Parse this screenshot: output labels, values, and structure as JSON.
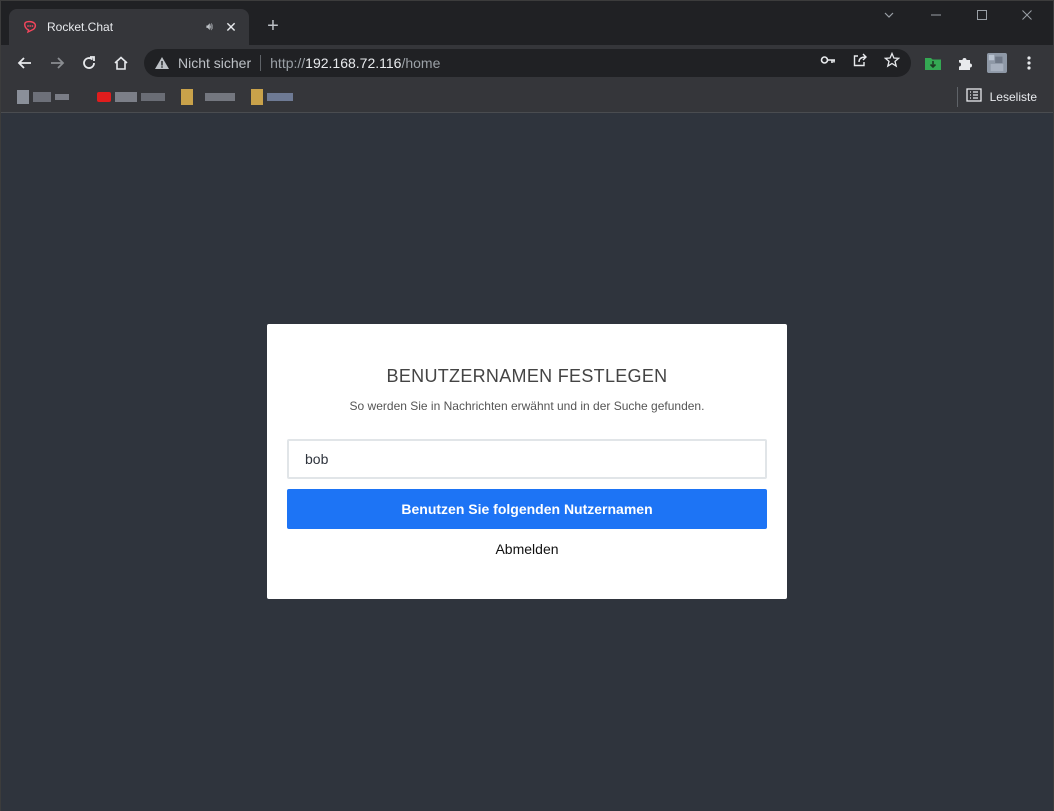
{
  "tab": {
    "title": "Rocket.Chat"
  },
  "toolbar": {
    "security_label": "Nicht sicher",
    "url_scheme": "http://",
    "url_host": "192.168.72.116",
    "url_path": "/home"
  },
  "bookmarks": {
    "reading_list_label": "Leseliste"
  },
  "colors": {
    "accent": "#1d74f5",
    "background": "#2f343d",
    "rocketchat_red": "#f5455c"
  },
  "icons": {
    "back": "arrow-left-icon",
    "forward": "arrow-right-icon",
    "reload": "reload-icon",
    "home": "home-icon",
    "warning": "warning-triangle-icon",
    "key": "key-icon",
    "share": "share-icon",
    "star": "star-icon",
    "extensions": "puzzle-icon",
    "menu": "kebab-menu-icon"
  },
  "modal": {
    "title": "BENUTZERNAMEN FESTLEGEN",
    "subtitle": "So werden Sie in Nachrichten erwähnt und in der Suche gefunden.",
    "username_value": "bob",
    "submit_label": "Benutzen Sie folgenden Nutzernamen",
    "logout_label": "Abmelden"
  }
}
